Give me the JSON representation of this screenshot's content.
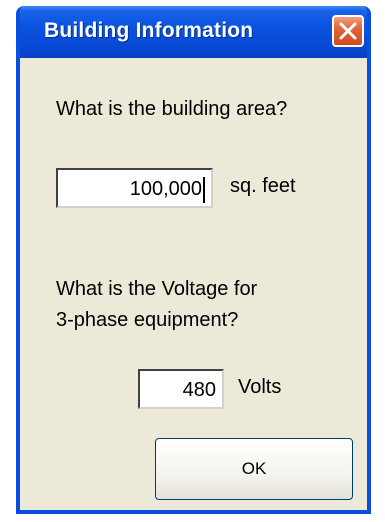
{
  "window": {
    "title": "Building Information",
    "accent_color": "#0a52df",
    "close_icon": "close-icon"
  },
  "area": {
    "prompt": "What is the building area?",
    "value": "100,000",
    "unit": "sq. feet"
  },
  "voltage": {
    "prompt_line1": "What is the Voltage for",
    "prompt_line2": "3-phase equipment?",
    "value": "480",
    "unit": "Volts"
  },
  "buttons": {
    "ok_label": "OK"
  }
}
